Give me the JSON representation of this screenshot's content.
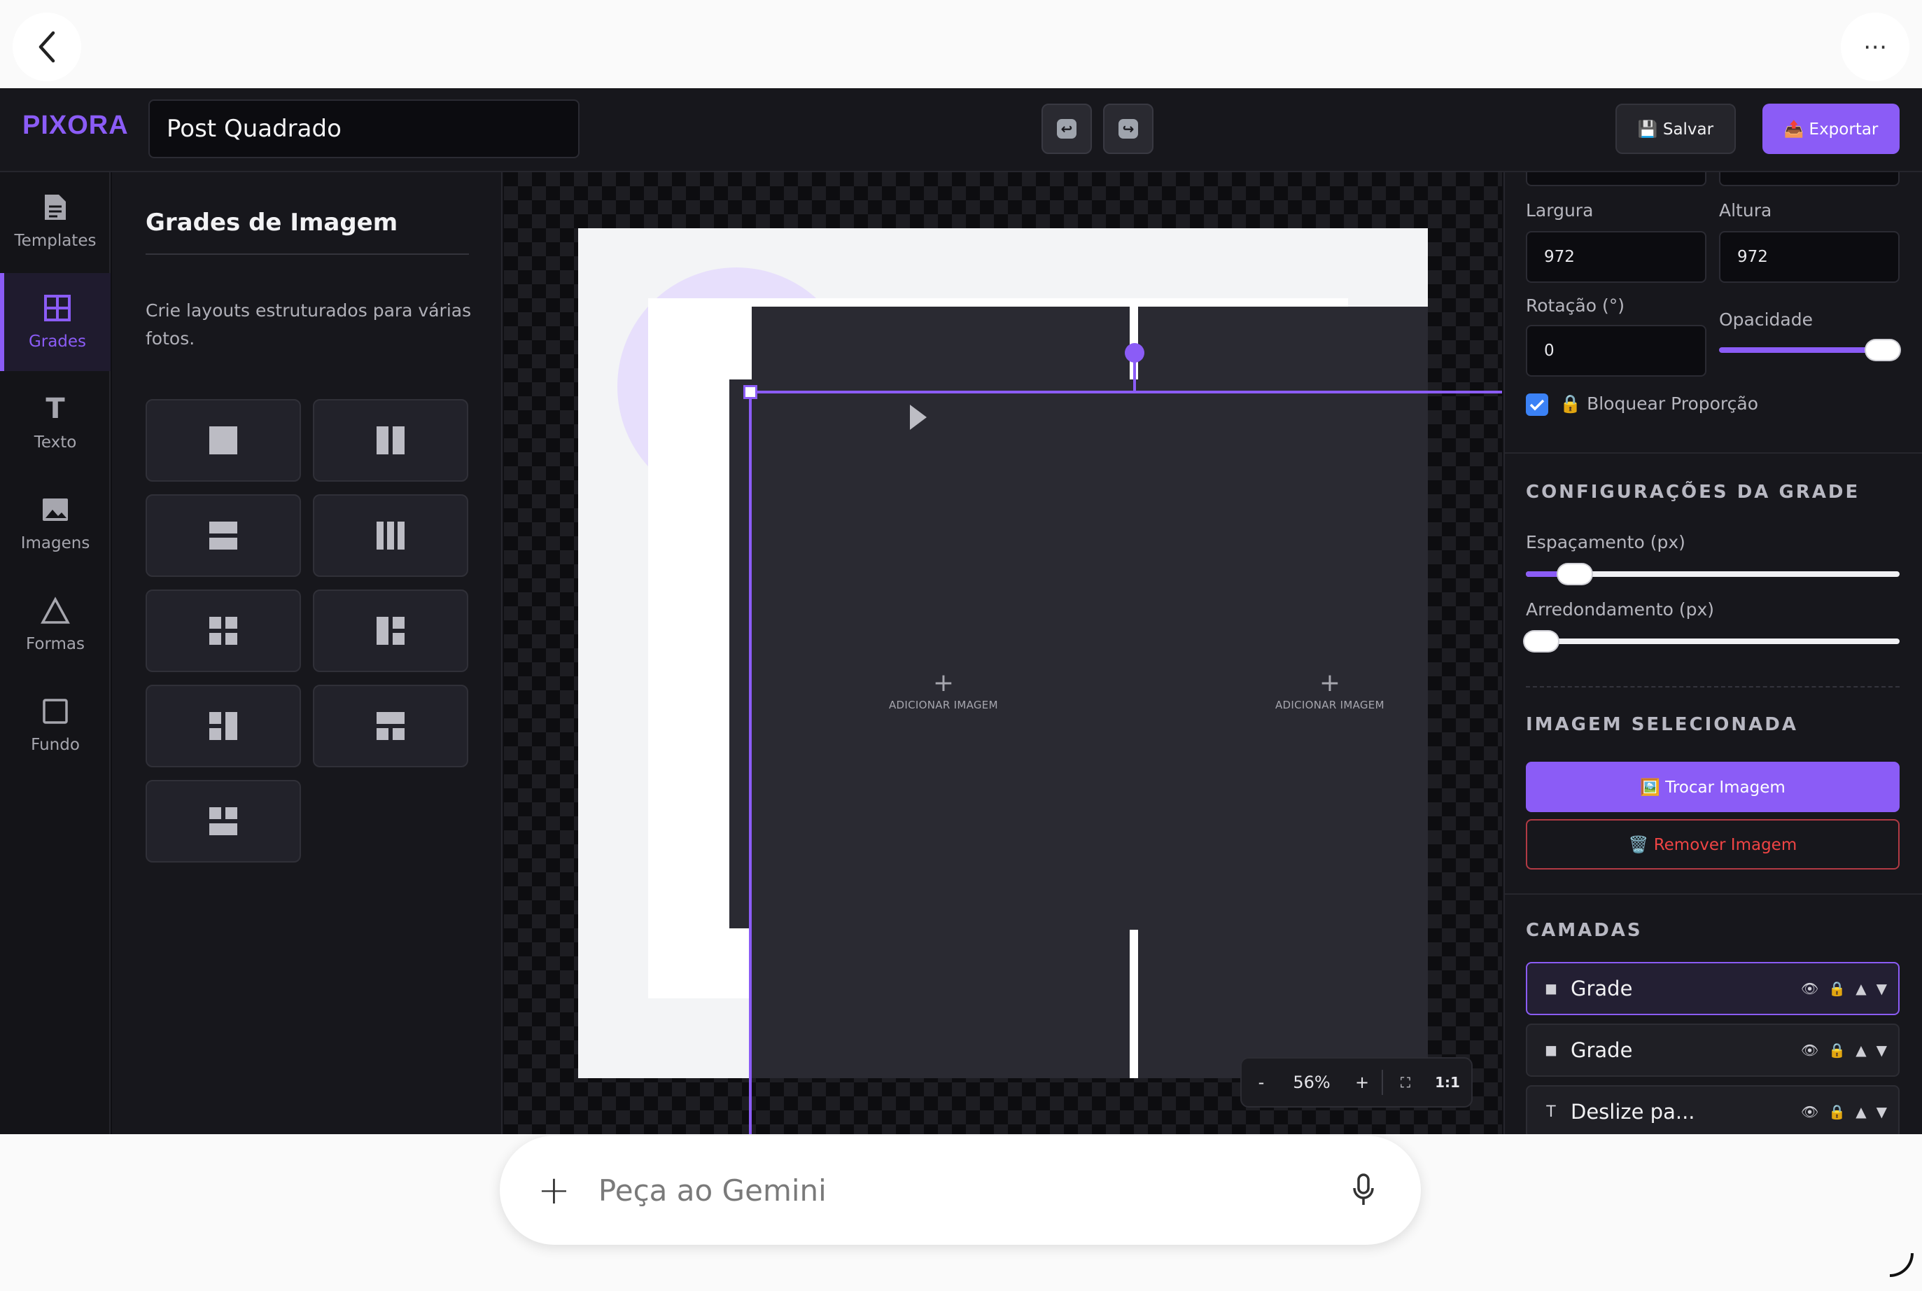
{
  "chrome": {
    "back_icon": "chevron-left-icon",
    "more_label": "⋯"
  },
  "app": {
    "logo": "PIXORA",
    "project_title": "Post Quadrado",
    "undo_icon": "undo-icon",
    "redo_icon": "redo-icon",
    "save_label": "💾 Salvar",
    "export_label": "📤 Exportar",
    "accent": "#8b5cf6"
  },
  "nav": {
    "items": [
      {
        "label": "Templates",
        "icon": "document-icon"
      },
      {
        "label": "Grades",
        "icon": "grid-icon"
      },
      {
        "label": "Texto",
        "icon": "text-icon"
      },
      {
        "label": "Imagens",
        "icon": "image-icon"
      },
      {
        "label": "Formas",
        "icon": "triangle-icon"
      },
      {
        "label": "Fundo",
        "icon": "square-icon"
      }
    ],
    "active": "Grades"
  },
  "grids_panel": {
    "title": "Grades de Imagem",
    "description": "Crie layouts estruturados para várias fotos.",
    "layouts": [
      "single",
      "two-columns",
      "two-rows",
      "three-columns",
      "four-grid",
      "left-big-right-two",
      "left-two-right-big",
      "top-two-bottom-one",
      "top-one-bottom-two"
    ]
  },
  "canvas": {
    "add_image_label": "ADICIONAR IMAGEM",
    "zoom": {
      "minus": "-",
      "value": "56%",
      "plus": "+",
      "fit_icon": "fit-screen-icon",
      "one_to_one": "1:1"
    }
  },
  "properties": {
    "width_label": "Largura",
    "width_value": "972",
    "height_label": "Altura",
    "height_value": "972",
    "rotation_label": "Rotação (°)",
    "rotation_value": "0",
    "opacity_label": "Opacidade",
    "opacity_value": 1.0,
    "lock_label": "🔒 Bloquear Proporção",
    "lock_checked": true
  },
  "grid_settings": {
    "title": "CONFIGURAÇÕES DA GRADE",
    "spacing_label": "Espaçamento (px)",
    "spacing_fraction": 0.13,
    "rounding_label": "Arredondamento (px)",
    "rounding_fraction": 0.0
  },
  "selected_image": {
    "title": "IMAGEM SELECIONADA",
    "replace_label": "🖼️ Trocar Imagem",
    "remove_label": "🗑️ Remover Imagem"
  },
  "layers": {
    "title": "CAMADAS",
    "items": [
      {
        "type_icon": "◼",
        "name": "Grade",
        "selected": true
      },
      {
        "type_icon": "◼",
        "name": "Grade",
        "selected": false
      },
      {
        "type_icon": "T",
        "name": "Deslize pa...",
        "selected": false
      }
    ],
    "controls": [
      "👁",
      "🔒",
      "▲",
      "▼"
    ]
  },
  "gemini": {
    "placeholder": "Peça ao Gemini",
    "plus": "+",
    "mic_icon": "microphone-icon"
  }
}
